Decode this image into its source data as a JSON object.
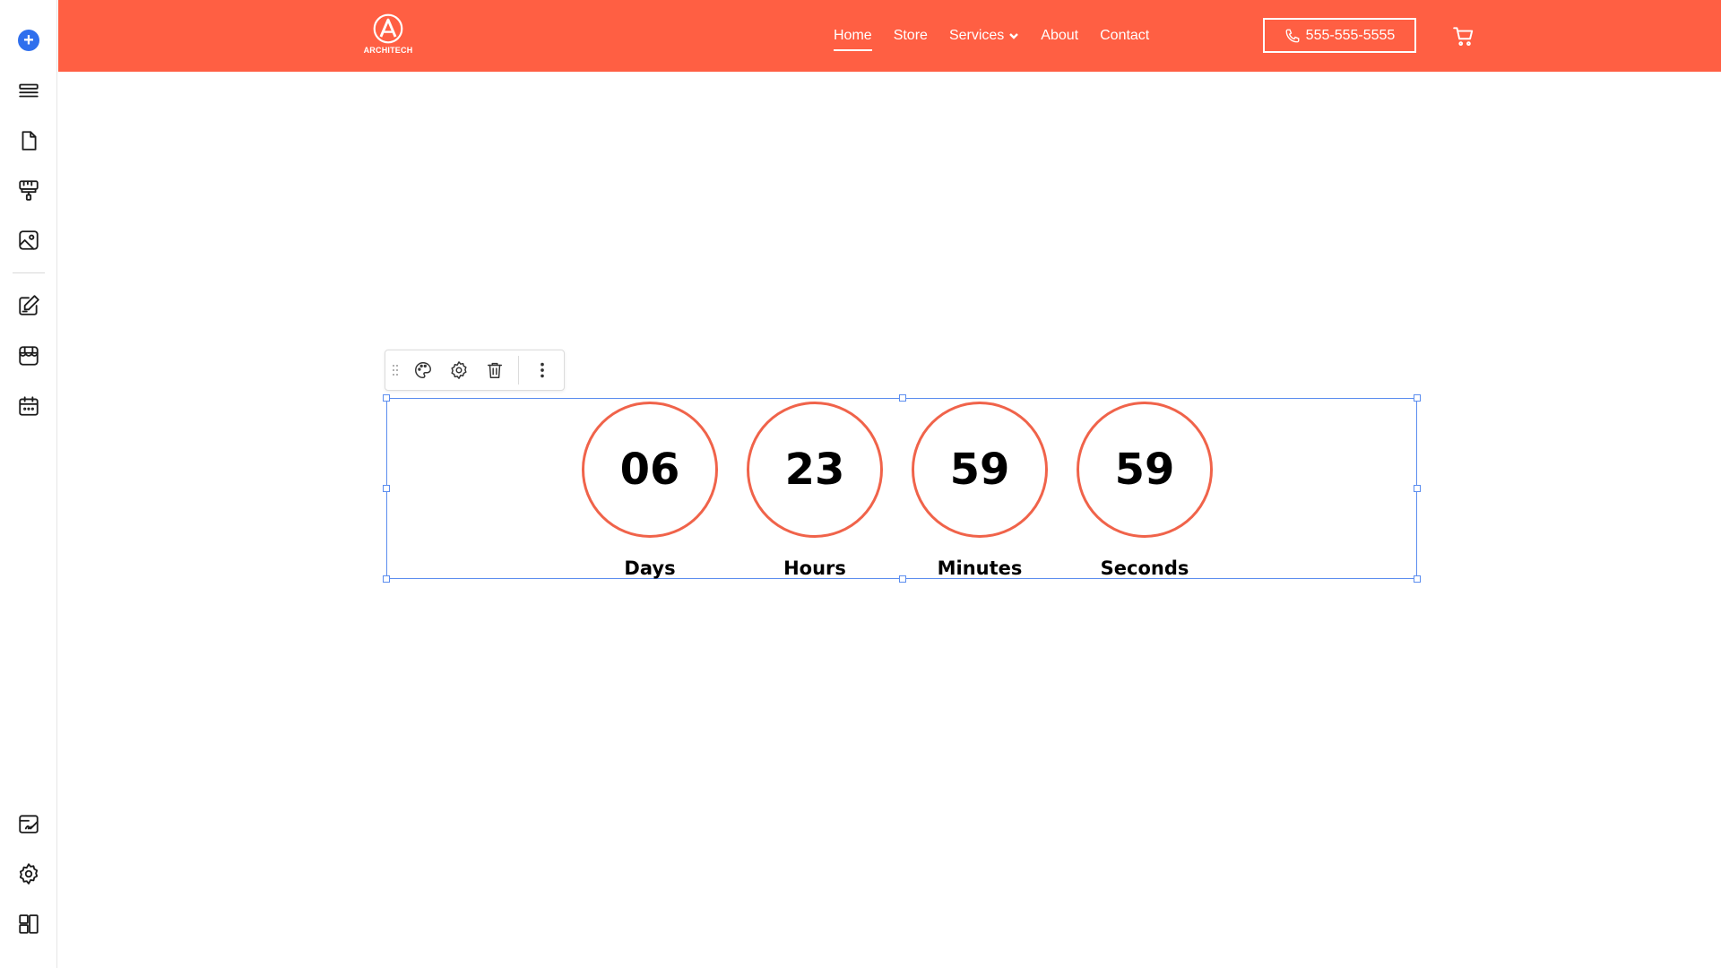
{
  "sidebar": {
    "add_label": "+",
    "items": [
      {
        "icon": "add-icon"
      },
      {
        "icon": "sections-icon"
      },
      {
        "icon": "pages-icon"
      },
      {
        "icon": "paint-roller-icon"
      },
      {
        "icon": "media-icon"
      },
      {
        "icon": "blog-edit-icon"
      },
      {
        "icon": "store-icon"
      },
      {
        "icon": "calendar-icon"
      },
      {
        "icon": "site-edit-icon"
      },
      {
        "icon": "settings-icon"
      },
      {
        "icon": "dashboard-icon"
      }
    ]
  },
  "header": {
    "logo_text": "ARCHITECH",
    "nav": [
      {
        "label": "Home",
        "active": true
      },
      {
        "label": "Store"
      },
      {
        "label": "Services"
      },
      {
        "label": "About"
      },
      {
        "label": "Contact"
      }
    ],
    "phone": "555-555-5555",
    "colors": {
      "brand": "#ff5f43"
    }
  },
  "toolbar": {
    "icons": [
      "drag-handle-icon",
      "palette-icon",
      "gear-icon",
      "trash-icon",
      "more-vertical-icon"
    ]
  },
  "countdown": {
    "accent": "#f0634a",
    "units": [
      {
        "value": "06",
        "label": "Days"
      },
      {
        "value": "23",
        "label": "Hours"
      },
      {
        "value": "59",
        "label": "Minutes"
      },
      {
        "value": "59",
        "label": "Seconds"
      }
    ]
  }
}
